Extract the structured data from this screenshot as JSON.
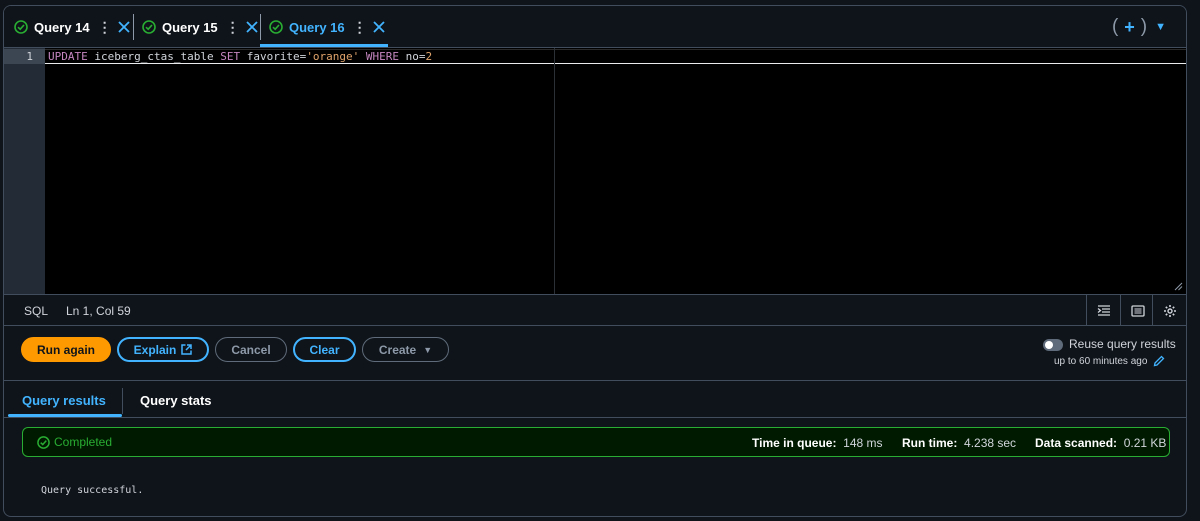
{
  "tabs": [
    {
      "label": "Query 14",
      "status": "completed"
    },
    {
      "label": "Query 15",
      "status": "completed"
    },
    {
      "label": "Query 16",
      "status": "completed",
      "active": true
    }
  ],
  "editor": {
    "line_number": "1",
    "code_tokens": [
      {
        "text": "UPDATE",
        "kind": "keyword"
      },
      {
        "text": " iceberg_ctas_table ",
        "kind": "plain"
      },
      {
        "text": "SET",
        "kind": "keyword"
      },
      {
        "text": " favorite=",
        "kind": "plain"
      },
      {
        "text": "'orange'",
        "kind": "string"
      },
      {
        "text": " ",
        "kind": "plain"
      },
      {
        "text": "WHERE",
        "kind": "keyword"
      },
      {
        "text": " no=",
        "kind": "plain"
      },
      {
        "text": "2",
        "kind": "number"
      }
    ]
  },
  "statusbar": {
    "language": "SQL",
    "cursor": "Ln 1, Col 59"
  },
  "actions": {
    "run_again": "Run again",
    "explain": "Explain",
    "cancel": "Cancel",
    "clear": "Clear",
    "create": "Create"
  },
  "reuse": {
    "label": "Reuse query results",
    "sub": "up to 60 minutes ago"
  },
  "results_tabs": {
    "results": "Query results",
    "stats": "Query stats"
  },
  "status": {
    "completed": "Completed",
    "time_in_queue_label": "Time in queue:",
    "time_in_queue_value": "148 ms",
    "run_time_label": "Run time:",
    "run_time_value": "4.238 sec",
    "data_scanned_label": "Data scanned:",
    "data_scanned_value": "0.21 KB"
  },
  "result_message": "Query successful.",
  "colors": {
    "accent": "#42b4ff",
    "primary_button": "#ff9900",
    "success": "#29ad32",
    "keyword": "#c586c0",
    "string": "#e0a36b"
  }
}
